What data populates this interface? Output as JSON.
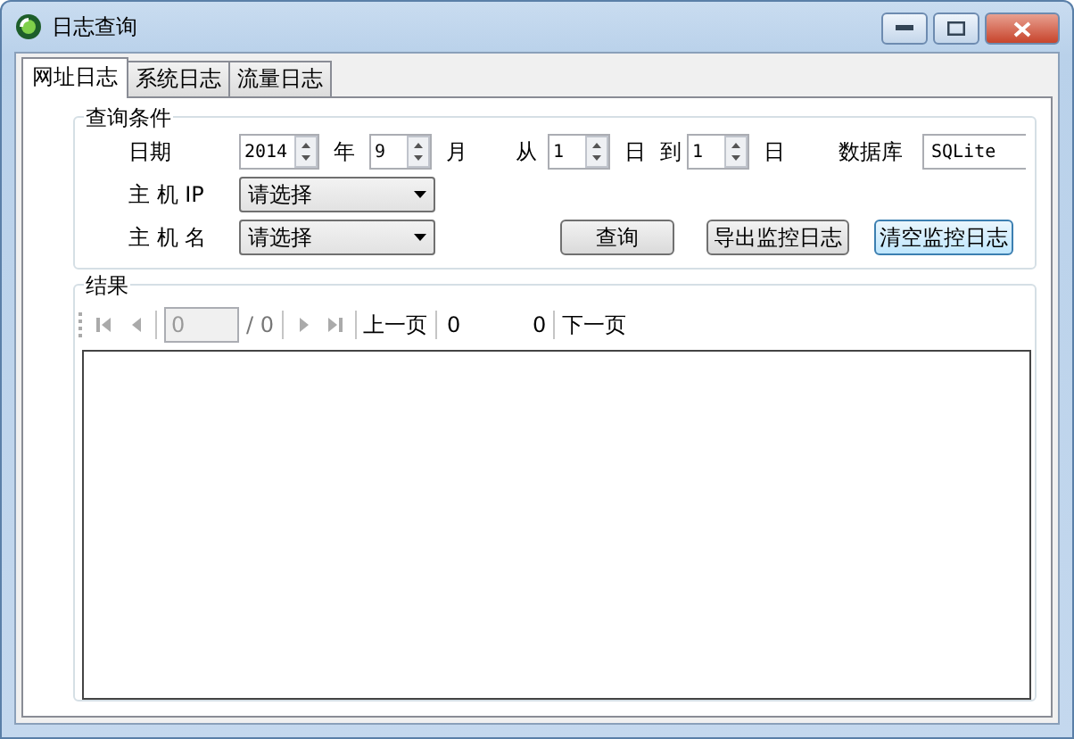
{
  "window": {
    "title": "日志查询"
  },
  "tabs": [
    {
      "label": "网址日志",
      "selected": true
    },
    {
      "label": "系统日志",
      "selected": false
    },
    {
      "label": "流量日志",
      "selected": false
    }
  ],
  "query": {
    "title": "查询条件",
    "date_label": "日期",
    "year": "2014",
    "year_unit": "年",
    "month": "9",
    "month_unit": "月",
    "from_label": "从",
    "from_day": "1",
    "from_unit": "日",
    "to_label": "到",
    "to_day": "1",
    "to_unit": "日",
    "database_label": "数据库",
    "database": "SQLite",
    "host_ip_label": "主 机 IP",
    "host_ip": "请选择",
    "host_name_label": "主 机 名",
    "host_name": "请选择",
    "buttons": [
      {
        "label": "查询",
        "highlighted": false
      },
      {
        "label": "导出监控日志",
        "highlighted": false
      },
      {
        "label": "清空监控日志",
        "highlighted": true
      }
    ]
  },
  "results": {
    "title": "结果",
    "nav_buttons": [
      {
        "kind": "first",
        "disabled": true
      },
      {
        "kind": "prev",
        "disabled": true
      }
    ],
    "page": "0",
    "page_total": "/ 0",
    "nav_buttons_after": [
      {
        "kind": "next",
        "disabled": true
      },
      {
        "kind": "last",
        "disabled": true
      }
    ],
    "prev_page": "上一页",
    "count_field": "0",
    "count": "0",
    "next_page": "下一页"
  }
}
